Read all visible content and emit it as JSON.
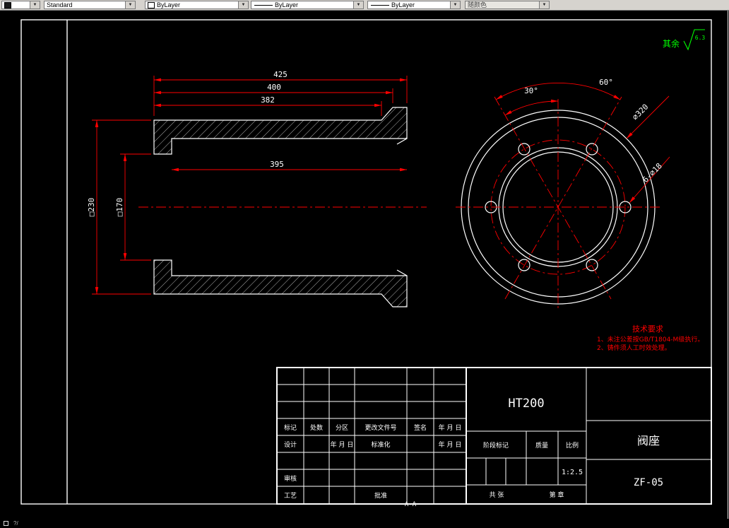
{
  "toolbar": {
    "combos": [
      {
        "id": "layer",
        "label": ""
      },
      {
        "id": "text-style",
        "label": "Standard"
      },
      {
        "id": "color",
        "label": "ByLayer"
      },
      {
        "id": "linetype",
        "label": "ByLayer"
      },
      {
        "id": "lineweight",
        "label": "ByLayer"
      },
      {
        "id": "plot-style",
        "label": "随颜色"
      }
    ]
  },
  "drawing": {
    "surface_label": "其余",
    "surface_value": "6.3",
    "dims": {
      "len_overall": "425",
      "len_step": "400",
      "len_inner": "382",
      "bore_depth": "395",
      "outer_sq": "□230",
      "inner_sq": "□170",
      "angle_major": "60°",
      "angle_minor": "30°",
      "dia_outer": "⌀320",
      "holes": "6-⌀18"
    },
    "tech_title": "技术要求",
    "tech_line1": "1、未注公差按GB/T1804-M级执行。",
    "tech_line2": "2、铸件须人工时效处理。",
    "section_label": "A-A"
  },
  "titleblock": {
    "material": "HT200",
    "part_name": "阀座",
    "drawing_no": "ZF-05",
    "scale_value": "1:2.5",
    "labels": {
      "mark": "标记",
      "count": "处数",
      "zone": "分区",
      "change_doc": "更改文件号",
      "sign": "签名",
      "date1": "年 月 日",
      "design": "设计",
      "date2": "年 月 日",
      "standardize": "标准化",
      "date3": "年 月 日",
      "review": "审核",
      "process": "工艺",
      "approve": "批准",
      "stage_mark": "阶段标记",
      "weight": "质量",
      "scale": "比例",
      "total_sheets": "共  张",
      "sheet_no": "第  章"
    }
  },
  "statusbar": {
    "hint": "?/"
  },
  "colors": {
    "background": "#000000",
    "geometry": "#ffffff",
    "dimension": "#ff0000",
    "annotation_green": "#00ff00",
    "toolbar": "#d6d3ce"
  }
}
